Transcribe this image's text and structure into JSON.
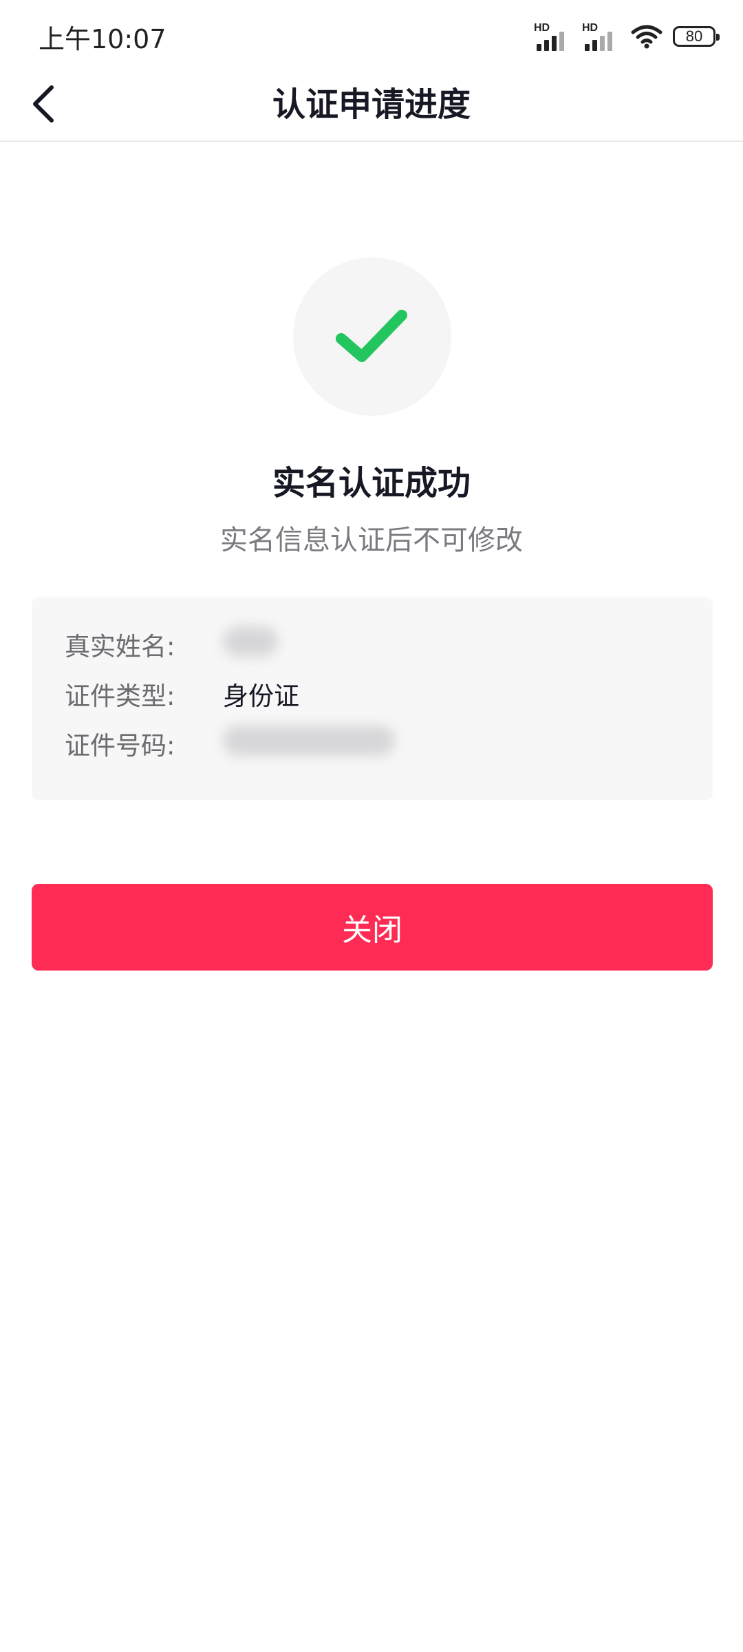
{
  "status_bar": {
    "time": "上午10:07",
    "signal1_label": "HD",
    "signal2_label": "HD",
    "battery": "80"
  },
  "nav": {
    "title": "认证申请进度",
    "back_icon": "chevron-left-icon"
  },
  "result": {
    "icon": "checkmark-icon",
    "icon_color": "#22c55e",
    "title": "实名认证成功",
    "subtitle": "实名信息认证后不可修改"
  },
  "info": {
    "rows": [
      {
        "label": "真实姓名:",
        "value": ""
      },
      {
        "label": "证件类型:",
        "value": "身份证"
      },
      {
        "label": "证件号码:",
        "value": ""
      }
    ]
  },
  "actions": {
    "close_label": "关闭",
    "close_color": "#fe2c55"
  }
}
